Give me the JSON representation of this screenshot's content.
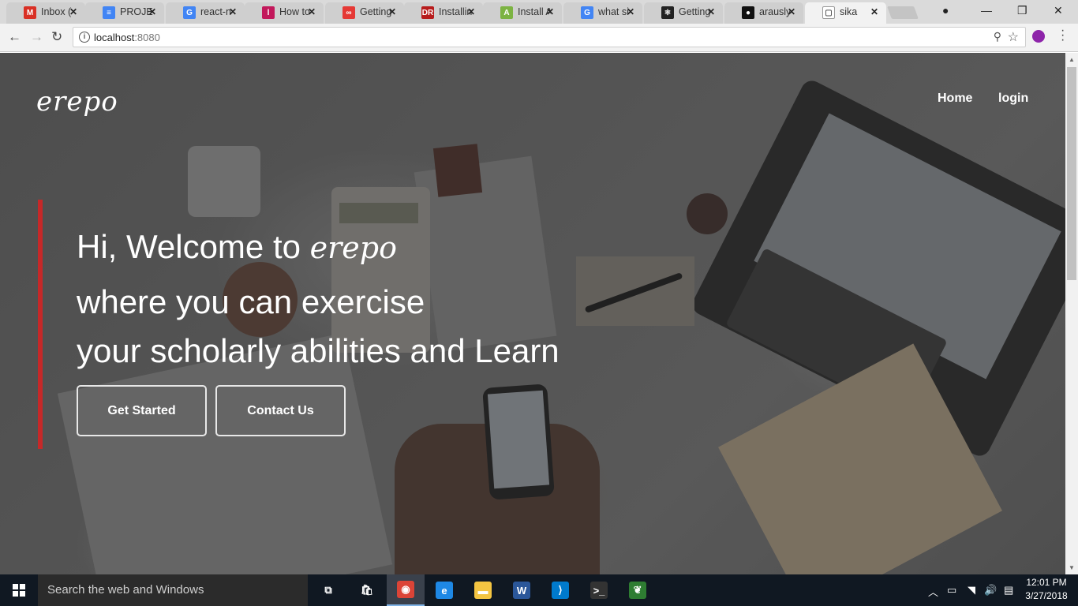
{
  "browser": {
    "tabs": [
      {
        "label": "Inbox (",
        "icon": "gmail-icon",
        "color": "#d93025",
        "glyph": "M"
      },
      {
        "label": "PROJEC",
        "icon": "google-docs-icon",
        "color": "#4285f4",
        "glyph": "≡"
      },
      {
        "label": "react-n",
        "icon": "google-icon",
        "color": "#4285f4",
        "glyph": "G"
      },
      {
        "label": "How to",
        "icon": "site-icon",
        "color": "#c2185b",
        "glyph": "l"
      },
      {
        "label": "Getting",
        "icon": "infinity-icon",
        "color": "#e53935",
        "glyph": "∞"
      },
      {
        "label": "Installin",
        "icon": "dr-icon",
        "color": "#b71c1c",
        "glyph": "DR"
      },
      {
        "label": "Install A",
        "icon": "android-icon",
        "color": "#7cb342",
        "glyph": "A"
      },
      {
        "label": "what si",
        "icon": "google-icon",
        "color": "#4285f4",
        "glyph": "G"
      },
      {
        "label": "Getting",
        "icon": "react-icon",
        "color": "#222222",
        "glyph": "⚛"
      },
      {
        "label": "arausly",
        "icon": "github-icon",
        "color": "#111111",
        "glyph": "●"
      },
      {
        "label": "sika",
        "icon": "page-icon",
        "color": "#ffffff",
        "glyph": "▢"
      }
    ],
    "close_glyph": "✕",
    "url_host": "localhost",
    "url_port": ":8080",
    "back_glyph": "←",
    "forward_glyph": "→",
    "reload_glyph": "↻",
    "minimize_glyph": "—",
    "restore_glyph": "❐",
    "window_close_glyph": "✕"
  },
  "site": {
    "logo": "erepo",
    "nav": {
      "home": "Home",
      "login": "login"
    },
    "hero": {
      "line1_prefix": "Hi, Welcome to ",
      "line1_brand": "erepo",
      "line2": "where you can exercise",
      "line3": "your scholarly abilities and Learn"
    },
    "buttons": {
      "get_started": "Get Started",
      "contact_us": "Contact Us"
    },
    "accent_color": "#c62828"
  },
  "taskbar": {
    "search_placeholder": "Search the web and Windows",
    "apps": [
      {
        "name": "task-view-icon",
        "glyph": "⧉",
        "color": "transparent"
      },
      {
        "name": "store-icon",
        "glyph": "🛍",
        "color": "transparent"
      },
      {
        "name": "chrome-icon",
        "glyph": "◉",
        "color": "#db4437"
      },
      {
        "name": "edge-icon",
        "glyph": "e",
        "color": "#1e88e5"
      },
      {
        "name": "file-explorer-icon",
        "glyph": "▬",
        "color": "#f4c542"
      },
      {
        "name": "word-icon",
        "glyph": "W",
        "color": "#2b579a"
      },
      {
        "name": "vscode-icon",
        "glyph": "⟩",
        "color": "#007acc"
      },
      {
        "name": "terminal-icon",
        "glyph": ">_",
        "color": "#333333"
      },
      {
        "name": "mongodb-icon",
        "glyph": "❦",
        "color": "#2e7d32"
      }
    ],
    "time": "12:01 PM",
    "date": "3/27/2018"
  }
}
